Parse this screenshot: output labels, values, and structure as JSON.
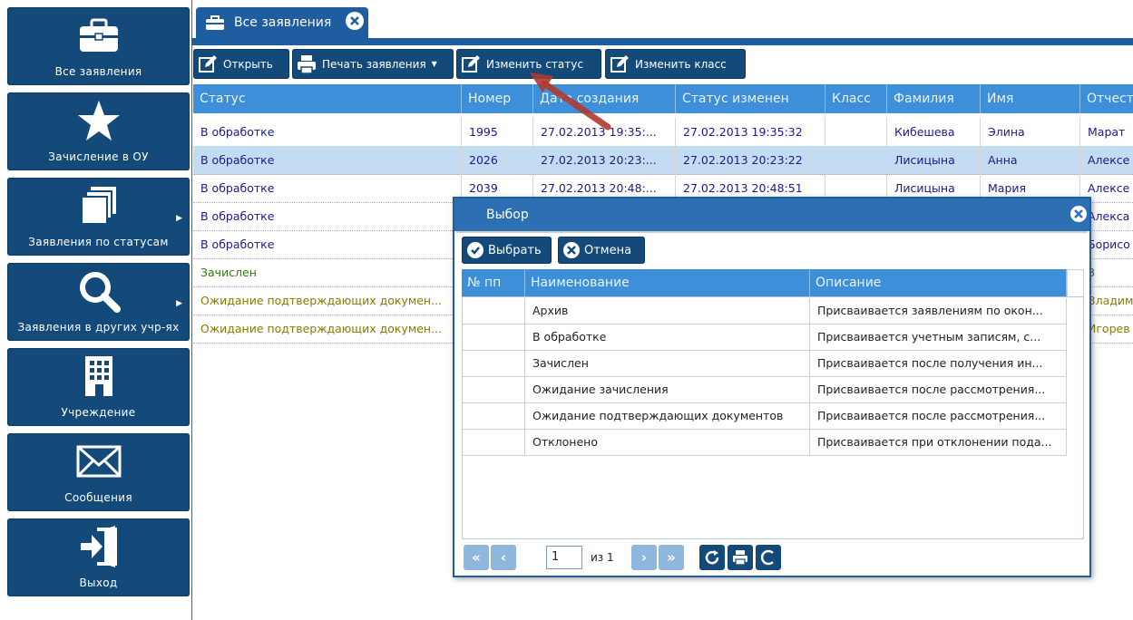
{
  "sidebar": {
    "items": [
      {
        "label": "Все заявления",
        "icon": "briefcase-icon"
      },
      {
        "label": "Зачисление в ОУ",
        "icon": "star-icon"
      },
      {
        "label": "Заявления по статусам",
        "icon": "copy-icon"
      },
      {
        "label": "Заявления в других учр-ях",
        "icon": "search-icon"
      },
      {
        "label": "Учреждение",
        "icon": "building-icon"
      },
      {
        "label": "Сообщения",
        "icon": "envelope-icon"
      },
      {
        "label": "Выход",
        "icon": "logout-icon"
      }
    ]
  },
  "tab": {
    "label": "Все заявления",
    "icon": "briefcase-icon",
    "close_icon": "close-icon"
  },
  "toolbar": {
    "open_label": "Открыть",
    "print_label": "Печать заявления",
    "change_status_label": "Изменить статус",
    "change_class_label": "Изменить класс"
  },
  "grid": {
    "columns": [
      "Статус",
      "Номер",
      "Дата создания",
      "Статус изменен",
      "Класс",
      "Фамилия",
      "Имя",
      "Отчество"
    ],
    "rows": [
      {
        "status": "В обработке",
        "num": "1995",
        "created": "27.02.2013 19:35:...",
        "changed": "27.02.2013 19:35:32",
        "cls": "",
        "last": "Кибешева",
        "first": "Элина",
        "middle": "Марат"
      },
      {
        "status": "В обработке",
        "num": "2026",
        "created": "27.02.2013 20:23:...",
        "changed": "27.02.2013 20:23:22",
        "cls": "",
        "last": "Лисицына",
        "first": "Анна",
        "middle": "Алексе"
      },
      {
        "status": "В обработке",
        "num": "2039",
        "created": "27.02.2013 20:48:...",
        "changed": "27.02.2013 20:48:51",
        "cls": "",
        "last": "Лисицына",
        "first": "Мария",
        "middle": "Алексе"
      },
      {
        "status": "В обработке",
        "middle": "Алекса"
      },
      {
        "status": "В обработке",
        "middle": "Борисо"
      },
      {
        "status": "Зачислен",
        "middle": "З"
      },
      {
        "status": "Ожидание подтверждающих докумен...",
        "middle": "Владим"
      },
      {
        "status": "Ожидание подтверждающих докумен...",
        "middle": "Игорев"
      }
    ],
    "colors": {
      "processing": "#1a1a8c",
      "enrolled": "#2e7d10",
      "waiting": "#8a7a00"
    }
  },
  "dialog": {
    "title": "Выбор",
    "select_label": "Выбрать",
    "cancel_label": "Отмена",
    "columns": [
      "№ пп",
      "Наименование",
      "Описание"
    ],
    "rows": [
      {
        "name": "Архив",
        "desc": "Присваивается заявлениям по окон..."
      },
      {
        "name": "В обработке",
        "desc": "Присваивается учетным записям, с..."
      },
      {
        "name": "Зачислен",
        "desc": "Присваивается после получения ин..."
      },
      {
        "name": "Ожидание зачисления",
        "desc": "Присваивается после рассмотрения..."
      },
      {
        "name": "Ожидание подтверждающих документов",
        "desc": "Присваивается после рассмотрения..."
      },
      {
        "name": "Отклонено",
        "desc": "Присваивается при отклонении пода..."
      }
    ],
    "pager": {
      "page_value": "1",
      "of_label": "из 1"
    }
  }
}
